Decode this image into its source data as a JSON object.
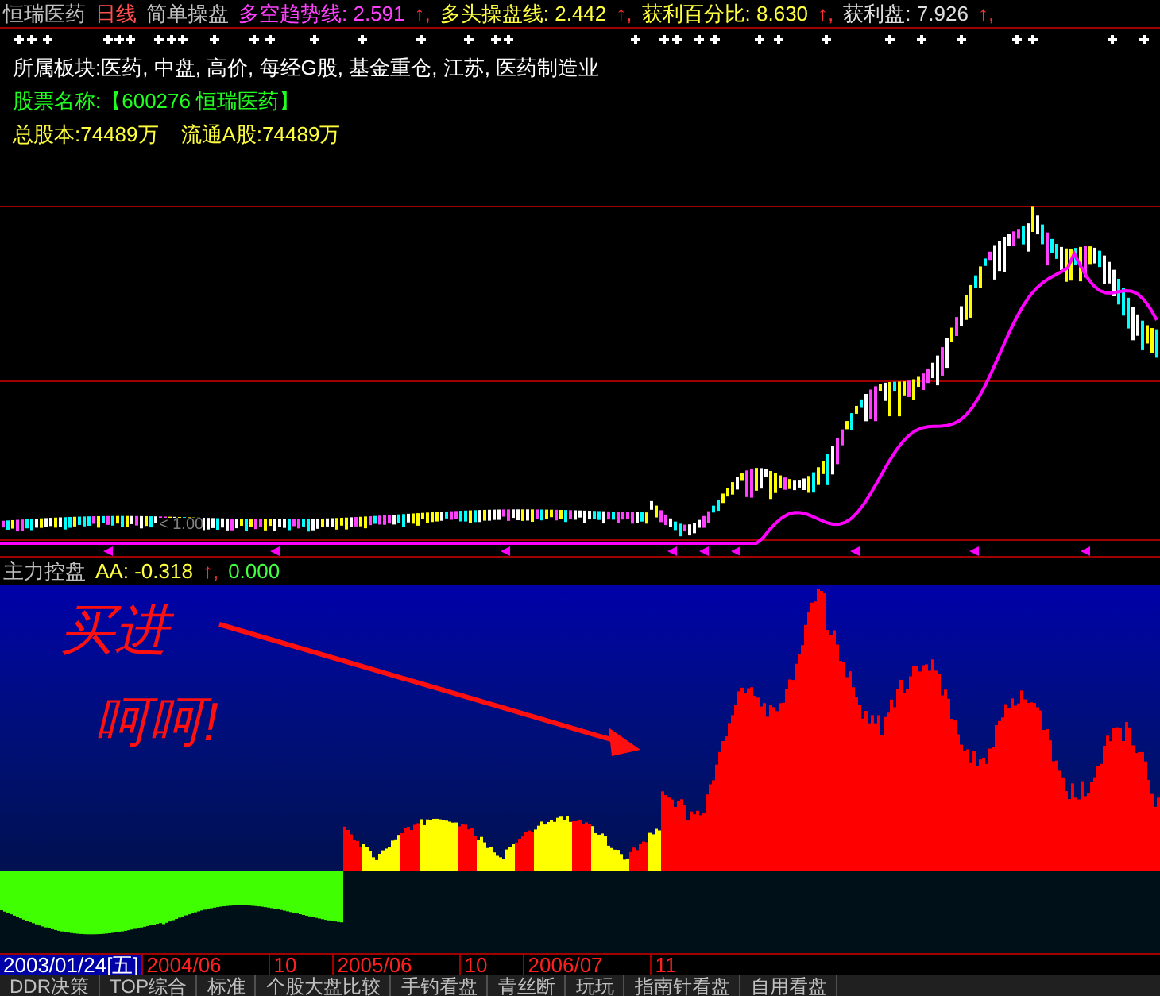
{
  "main_chart": {
    "legend": [
      {
        "text": "恒瑞医药",
        "color": "#c0c0c0"
      },
      {
        "text": "日线",
        "color": "#ff5050"
      },
      {
        "text": "简单操盘",
        "color": "#c0c0c0"
      },
      {
        "text": "多空趋势线: 2.591",
        "color": "#ff40ff"
      },
      {
        "text": "↑,",
        "color": "#ff3030"
      },
      {
        "text": "多头操盘线: 2.442",
        "color": "#ffff40"
      },
      {
        "text": "↑,",
        "color": "#ff3030"
      },
      {
        "text": "获利百分比: 8.630",
        "color": "#ffff40"
      },
      {
        "text": "↑,",
        "color": "#ff3030"
      },
      {
        "text": "获利盘: 7.926",
        "color": "#e0e0e0"
      },
      {
        "text": "↑,",
        "color": "#ff3030"
      }
    ],
    "info": [
      {
        "text": "所属板块:医药, 中盘, 高价, 每经G股, 基金重仓, 江苏, 医药制造业",
        "color": "#ffffff"
      },
      {
        "text": "股票名称:【600276 恒瑞医药】",
        "color": "#20ff20"
      },
      {
        "text": "总股本:74489万",
        "color": "#ffff40"
      },
      {
        "text": "流通A股:74489万",
        "color": "#ffff40"
      }
    ],
    "price_label": "< 1.00"
  },
  "indicator": {
    "legend": [
      {
        "text": "主力控盘",
        "color": "#c0c0c0"
      },
      {
        "text": "AA: -0.318",
        "color": "#ffff40"
      },
      {
        "text": "↑,",
        "color": "#ff3030"
      },
      {
        "text": "0.000",
        "color": "#40ff40"
      }
    ],
    "annotation": [
      "买进",
      "呵呵!"
    ]
  },
  "time_axis": {
    "cursor_date": "2003/01/24[五]",
    "labels": [
      "2004/06",
      "10",
      "2005/06",
      "10",
      "2006/07",
      "11"
    ]
  },
  "tabs": [
    "DDR决策",
    "TOP综合",
    "标准",
    "个股大盘比较",
    "手钓看盘",
    "青丝断",
    "玩玩",
    "指南针看盘",
    "自用看盘"
  ]
}
